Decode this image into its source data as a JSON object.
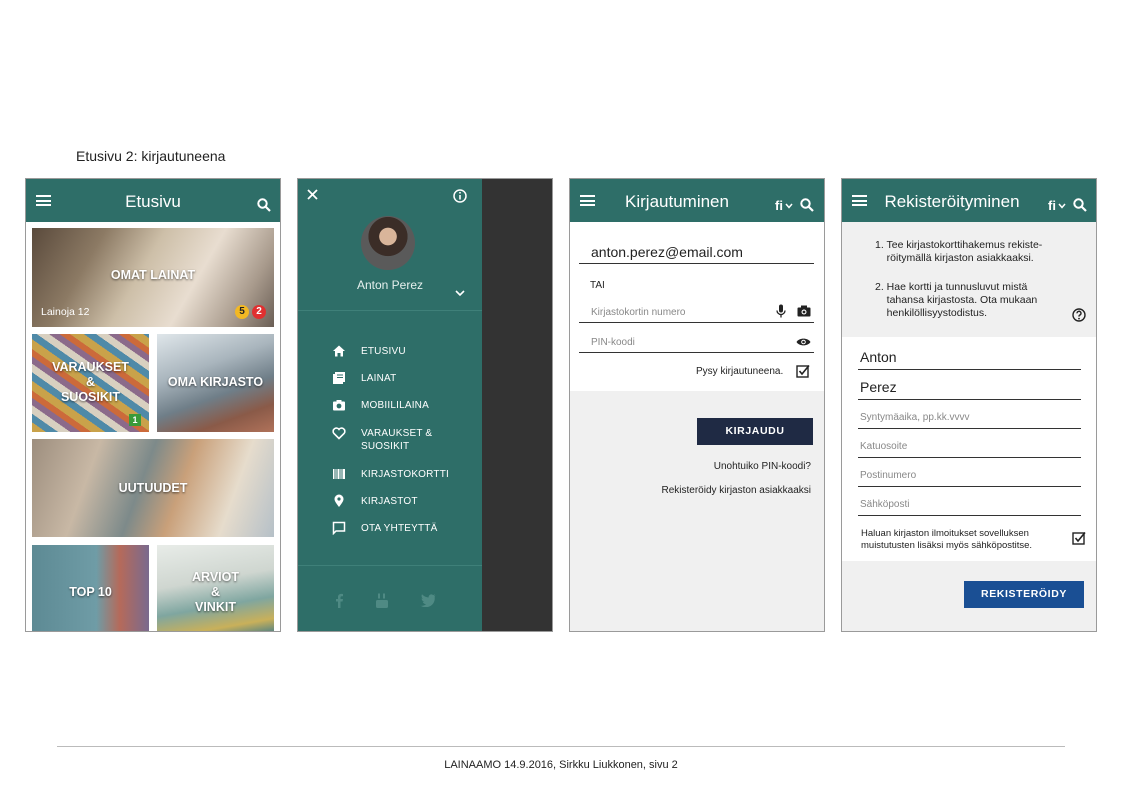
{
  "heading": "Etusivu 2: kirjautuneena",
  "footer": "LAINAAMO 14.9.2016, Sirkku Liukkonen, sivu 2",
  "colors": {
    "primary": "#2e6e68",
    "dark_overlay": "#333333",
    "button_navy": "#1f2a44",
    "button_blue": "#1a4f94"
  },
  "screen1": {
    "title": "Etusivu",
    "tiles": {
      "omat_lainat": "OMAT LAINAT",
      "lainoja": "Lainoja 12",
      "badge_yellow": "5",
      "badge_red": "2",
      "varaukset": "VARAUKSET\n&\nSUOSIKIT",
      "badge_green": "1",
      "oma_kirjasto": "OMA KIRJASTO",
      "uutuudet": "UUTUUDET",
      "top10": "TOP 10",
      "arviot": "ARVIOT\n&\nVINKIT"
    }
  },
  "screen2": {
    "user_name": "Anton Perez",
    "menu": [
      {
        "label": "ETUSIVU",
        "icon": "home-icon"
      },
      {
        "label": "LAINAT",
        "icon": "books-icon"
      },
      {
        "label": "MOBIILILAINA",
        "icon": "camera-icon"
      },
      {
        "label": "VARAUKSET &\nSUOSIKIT",
        "icon": "heart-icon"
      },
      {
        "label": "KIRJASTOKORTTI",
        "icon": "barcode-icon"
      },
      {
        "label": "KIRJASTOT",
        "icon": "location-pin-icon"
      },
      {
        "label": "OTA YHTEYTTÄ",
        "icon": "chat-icon"
      }
    ]
  },
  "screen3": {
    "title": "Kirjautuminen",
    "lang": "fi",
    "email_value": "anton.perez@email.com",
    "or_label": "TAI",
    "card_placeholder": "Kirjastokortin numero",
    "pin_placeholder": "PIN-koodi",
    "stay_logged": "Pysy kirjautuneena.",
    "login_button": "KIRJAUDU",
    "forgot_pin": "Unohtuiko PIN-koodi?",
    "register_link": "Rekisteröidy kirjaston asiakkaaksi"
  },
  "screen4": {
    "title": "Rekisteröityminen",
    "lang": "fi",
    "instructions": [
      "1. Tee kirjastokorttihakemus rekiste-\n    röitymällä kirjaston asiakkaaksi.",
      "2. Hae kortti ja tunnusluvut mistä\n    tahansa kirjastosta. Ota mukaan\n    henkilöllisyystodistus."
    ],
    "first_name": "Anton",
    "last_name": "Perez",
    "birthdate_placeholder": "Syntymäaika, pp.kk.vvvv",
    "address_placeholder": "Katuosoite",
    "postal_placeholder": "Postinumero",
    "email_placeholder": "Sähköposti",
    "notify_text": "Haluan kirjaston ilmoitukset sovelluksen\nmuistutusten lisäksi myös sähköpostitse.",
    "register_button": "REKISTERÖIDY"
  }
}
